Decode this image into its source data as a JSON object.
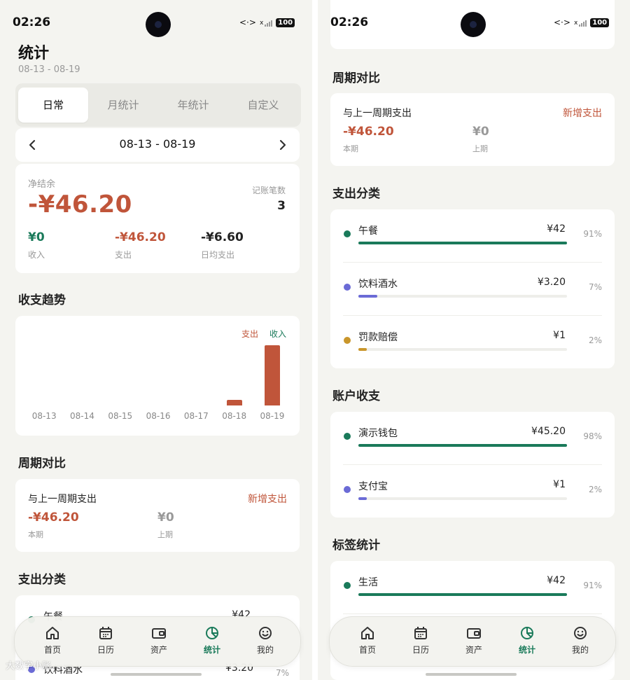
{
  "colors": {
    "expense": "#c0553a",
    "income": "#1a7a5a",
    "accent": "#1a7a5a",
    "muted": "#999999"
  },
  "status": {
    "time": "02:26",
    "battery": "100",
    "data_icon": "<·>",
    "signal_mark": "x"
  },
  "left": {
    "page_title": "统计",
    "page_range": "08-13 - 08-19",
    "tabs": [
      {
        "label": "日常",
        "active": true
      },
      {
        "label": "月统计",
        "active": false
      },
      {
        "label": "年统计",
        "active": false
      },
      {
        "label": "自定义",
        "active": false
      }
    ],
    "range_bar": {
      "prev_icon": "chevron-left-icon",
      "label": "08-13 - 08-19",
      "next_icon": "chevron-right-icon"
    },
    "summary": {
      "net_label": "净结余",
      "net_value": "-¥46.20",
      "count_label": "记账笔数",
      "count_value": "3",
      "income_value": "¥0",
      "income_label": "收入",
      "expense_value": "-¥46.20",
      "expense_label": "支出",
      "daily_value": "-¥6.60",
      "daily_label": "日均支出"
    },
    "trend_title": "收支趋势",
    "chart_data": {
      "type": "bar",
      "categories": [
        "08-13",
        "08-14",
        "08-15",
        "08-16",
        "08-17",
        "08-18",
        "08-19"
      ],
      "series": [
        {
          "name": "支出",
          "values": [
            0,
            0,
            0,
            0,
            0,
            3.2,
            43
          ]
        },
        {
          "name": "收入",
          "values": [
            0,
            0,
            0,
            0,
            0,
            0,
            0
          ]
        }
      ],
      "legend": [
        "支出",
        "收入"
      ],
      "legend_position": "top-right",
      "grid": false
    },
    "period_title": "周期对比",
    "period": {
      "label": "与上一周期支出",
      "new_label": "新增支出",
      "current_value": "-¥46.20",
      "current_label": "本期",
      "prev_value": "¥0",
      "prev_label": "上期"
    },
    "category_title": "支出分类",
    "peek_row": {
      "name": "午餐",
      "amount": "¥42"
    },
    "bottom_peek": {
      "name": "饮料酒水",
      "amount": "¥3.20",
      "pct": "7%"
    },
    "watermark": "大数字小账"
  },
  "right": {
    "period_title": "周期对比",
    "period": {
      "label": "与上一周期支出",
      "new_label": "新增支出",
      "current_value": "-¥46.20",
      "current_label": "本期",
      "prev_value": "¥0",
      "prev_label": "上期"
    },
    "category_title": "支出分类",
    "categories": [
      {
        "name": "午餐",
        "amount": "¥42",
        "pct": "91%",
        "fraction": 1.0,
        "color": "#1a7a5a"
      },
      {
        "name": "饮料酒水",
        "amount": "¥3.20",
        "pct": "7%",
        "fraction": 0.09,
        "color": "#6b6bd6"
      },
      {
        "name": "罚款赔偿",
        "amount": "¥1",
        "pct": "2%",
        "fraction": 0.04,
        "color": "#c9962b"
      }
    ],
    "account_title": "账户收支",
    "accounts": [
      {
        "name": "演示钱包",
        "amount": "¥45.20",
        "pct": "98%",
        "fraction": 1.0,
        "color": "#1a7a5a"
      },
      {
        "name": "支付宝",
        "amount": "¥1",
        "pct": "2%",
        "fraction": 0.04,
        "color": "#6b6bd6"
      }
    ],
    "tag_title": "标签统计",
    "tags": [
      {
        "name": "生活",
        "amount": "¥42",
        "pct": "91%",
        "fraction": 1.0,
        "color": "#1a7a5a"
      }
    ]
  },
  "nav": {
    "items": [
      {
        "label": "首页",
        "icon": "home-icon"
      },
      {
        "label": "日历",
        "icon": "calendar-icon"
      },
      {
        "label": "资产",
        "icon": "wallet-icon"
      },
      {
        "label": "统计",
        "icon": "pie-chart-icon",
        "active": true
      },
      {
        "label": "我的",
        "icon": "smile-icon"
      }
    ]
  }
}
